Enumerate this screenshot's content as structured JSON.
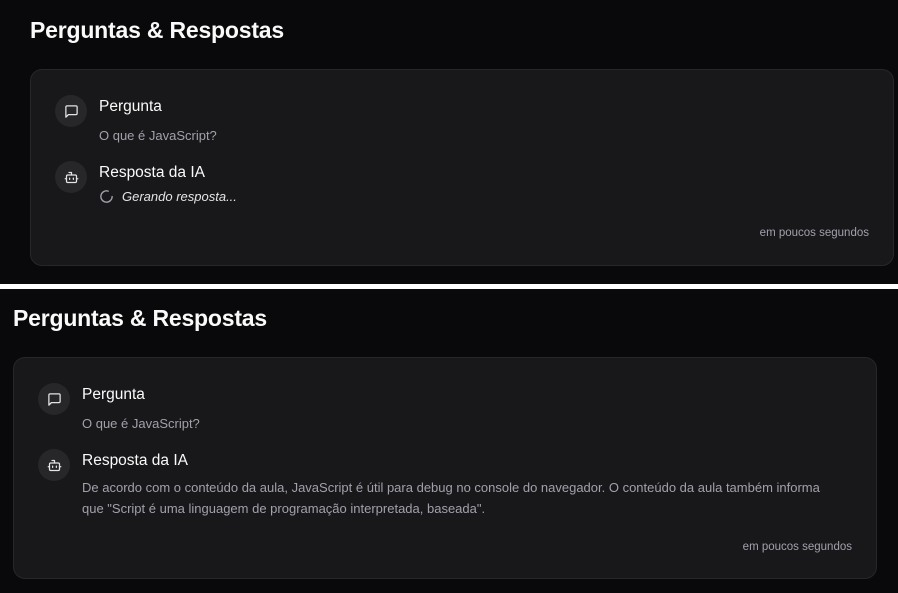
{
  "panels": [
    {
      "title": "Perguntas & Respostas",
      "question_label": "Pergunta",
      "question_text": "O que é JavaScript?",
      "answer_label": "Resposta da IA",
      "loading_text": "Gerando resposta...",
      "timestamp": "em poucos segundos"
    },
    {
      "title": "Perguntas & Respostas",
      "question_label": "Pergunta",
      "question_text": "O que é JavaScript?",
      "answer_label": "Resposta da IA",
      "answer_text": "De acordo com o conteúdo da aula, JavaScript é útil para debug no console do navegador. O conteúdo da aula também informa que \"Script é uma linguagem de programação interpretada, baseada\".",
      "timestamp": "em poucos segundos"
    }
  ],
  "icons": {
    "question": "message-square-icon",
    "answer": "bot-icon",
    "loading": "spinner-icon"
  },
  "colors": {
    "background": "#09090b",
    "card": "#18181b",
    "border": "#27272a",
    "text_primary": "#fafafa",
    "text_muted": "#a1a1aa"
  }
}
